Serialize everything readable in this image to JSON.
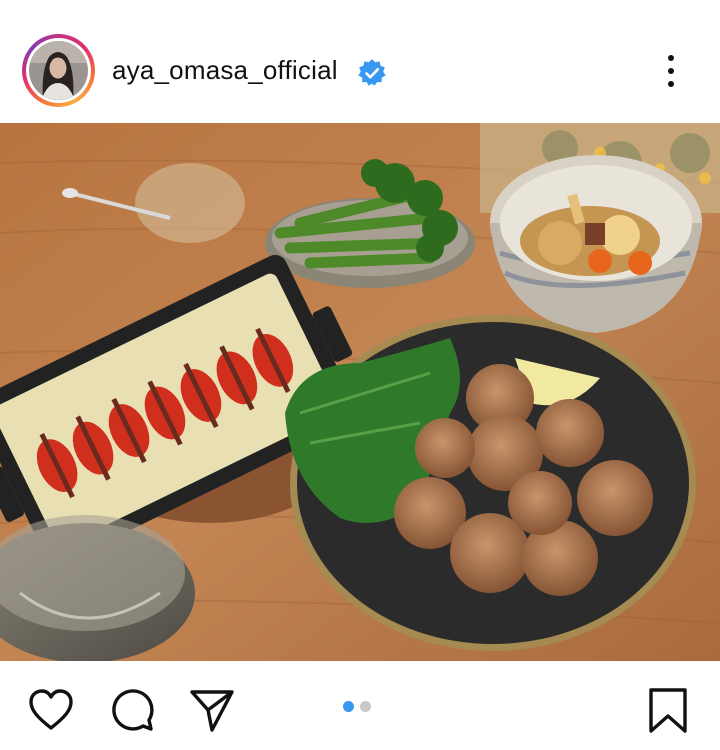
{
  "post": {
    "username": "aya_omasa_official",
    "verified": true,
    "image_alt": "Dinner table with fried chicken karaage, baked tomato and bacon gratin, broccolini, and simmered vegetables",
    "carousel": {
      "total": 2,
      "active": 1
    }
  },
  "icons": {
    "header": [
      "avatar",
      "verified-badge-icon",
      "more-options-icon"
    ],
    "actions": [
      "heart-icon",
      "comment-icon",
      "share-icon",
      "bookmark-icon"
    ]
  },
  "colors": {
    "verified_blue": "#3897f0",
    "active_dot": "#3897f0",
    "inactive_dot": "#c8c8c8",
    "text": "#111111"
  }
}
